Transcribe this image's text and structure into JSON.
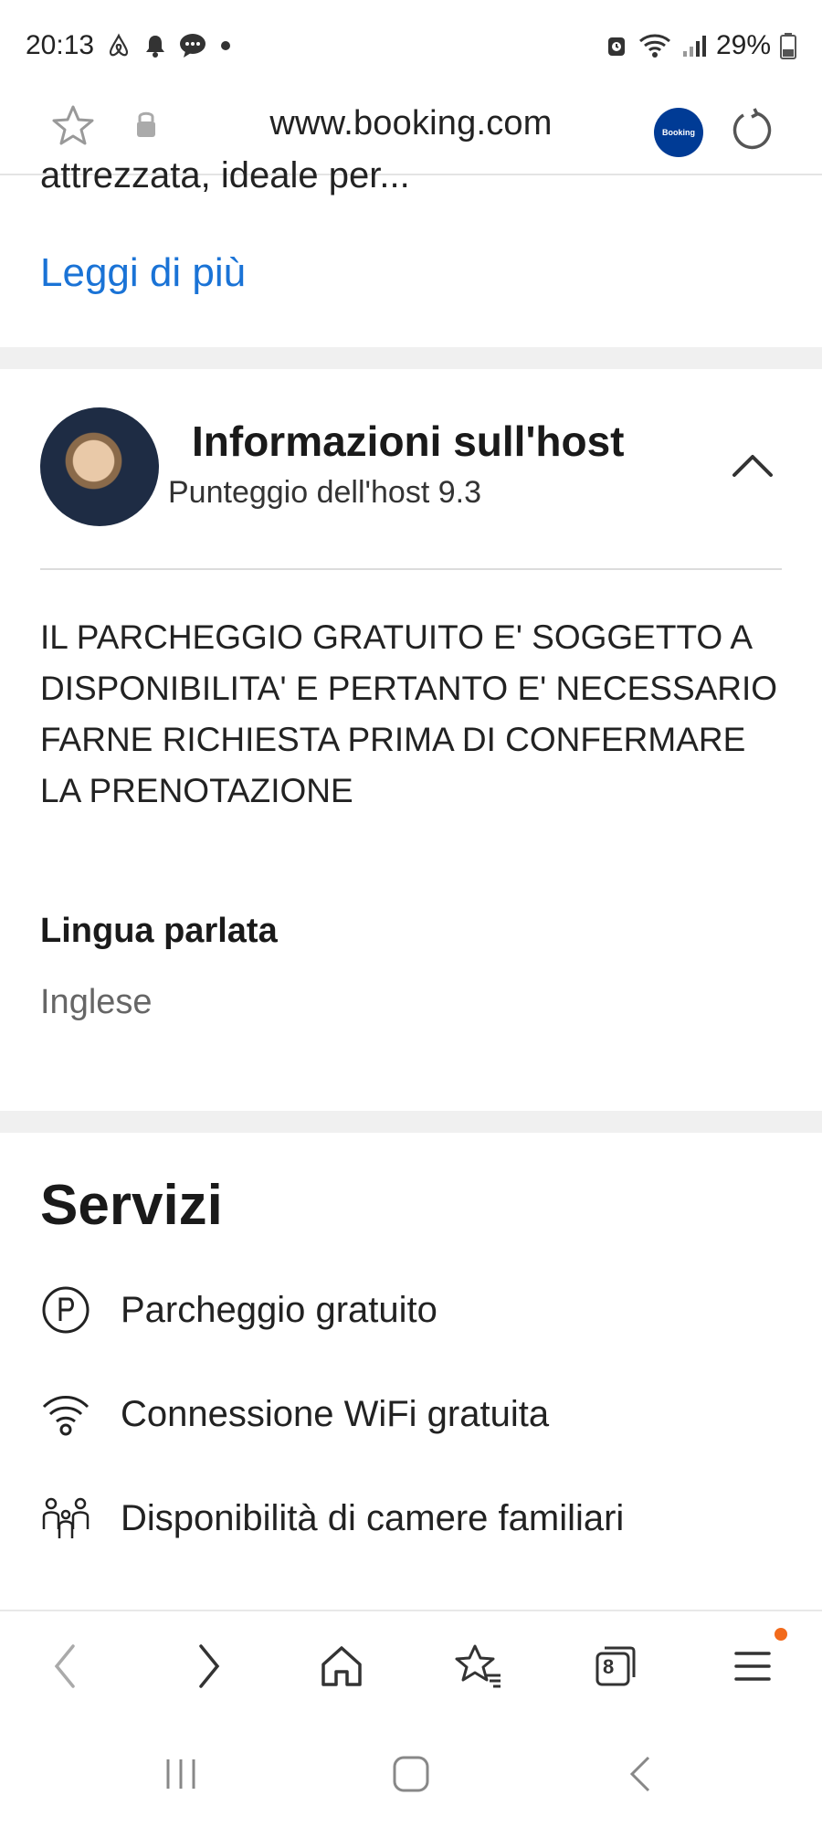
{
  "status_bar": {
    "time": "20:13",
    "battery": "29%",
    "icons_left": [
      "airbnb-icon",
      "bell-icon",
      "chat-icon",
      "dot-icon"
    ],
    "icons_right": [
      "alarm-icon",
      "wifi-icon",
      "signal-icon",
      "battery-icon"
    ]
  },
  "browser": {
    "url": "www.booking.com",
    "site_badge": "Booking"
  },
  "content": {
    "clipped_text": "attrezzata, ideale per...",
    "read_more": "Leggi di più"
  },
  "host": {
    "title": "Informazioni sull'host",
    "score": "Punteggio dell'host 9.3",
    "description": "IL PARCHEGGIO GRATUITO E' SOGGETTO A DISPONIBILITA' E PERTANTO E' NECESSARIO FARNE RICHIESTA PRIMA DI CONFERMARE LA PRENOTAZIONE",
    "language_label": "Lingua parlata",
    "language_value": "Inglese"
  },
  "services": {
    "title": "Servizi",
    "items": [
      {
        "label": "Parcheggio gratuito",
        "icon": "parking-icon"
      },
      {
        "label": "Connessione WiFi gratuita",
        "icon": "wifi-icon"
      },
      {
        "label": "Disponibilità di camere familiari",
        "icon": "family-icon"
      }
    ]
  },
  "toolbar": {
    "tabs_count": "8"
  },
  "colors": {
    "link": "#1a73d6",
    "booking_badge": "#003b95",
    "notification_dot": "#f26a1b"
  }
}
